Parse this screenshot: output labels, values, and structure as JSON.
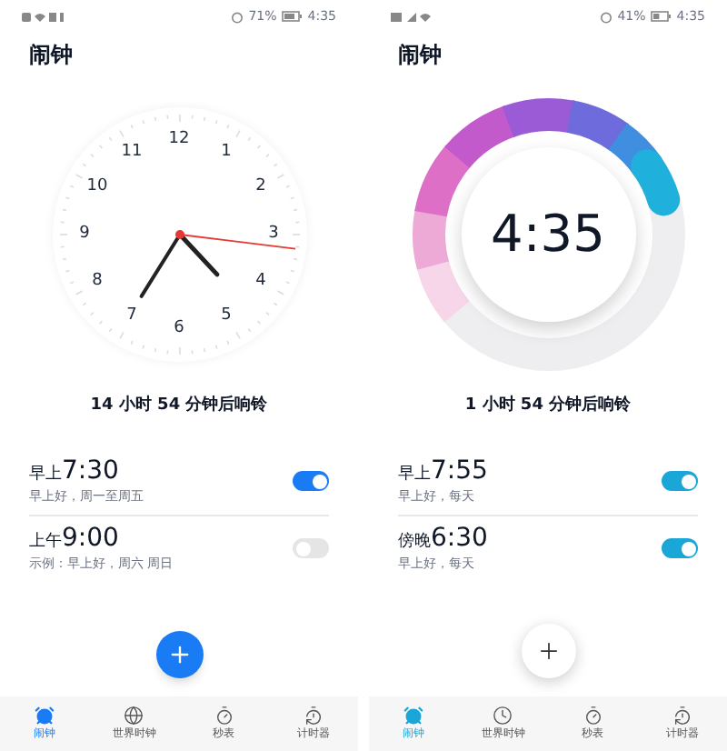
{
  "screens": [
    {
      "kind": "analog",
      "status_bar": {
        "battery": "71%",
        "time": "4:35"
      },
      "title": "闹钟",
      "clock_numbers": [
        "12",
        "1",
        "2",
        "3",
        "4",
        "5",
        "6",
        "7",
        "8",
        "9",
        "10",
        "11"
      ],
      "countdown": "14 小时 54 分钟后响铃",
      "alarms": [
        {
          "period": "早上",
          "time": "7:30",
          "label": "早上好，周一至周五",
          "on": true
        },
        {
          "period": "上午",
          "time": "9:00",
          "label": "示例：早上好，周六 周日",
          "on": false
        }
      ],
      "tabs": [
        {
          "label": "闹钟",
          "selected": true
        },
        {
          "label": "世界时钟",
          "selected": false
        },
        {
          "label": "秒表",
          "selected": false
        },
        {
          "label": "计时器",
          "selected": false
        }
      ]
    },
    {
      "kind": "ring",
      "status_bar": {
        "battery": "41%",
        "time": "4:35"
      },
      "title": "闹钟",
      "clock_time": "4:35",
      "countdown": "1 小时 54 分钟后响铃",
      "alarms": [
        {
          "period": "早上",
          "time": "7:55",
          "label": "早上好，每天",
          "on": true
        },
        {
          "period": "傍晚",
          "time": "6:30",
          "label": "早上好，每天",
          "on": true
        }
      ],
      "tabs": [
        {
          "label": "闹钟",
          "selected": true
        },
        {
          "label": "世界时钟",
          "selected": false
        },
        {
          "label": "秒表",
          "selected": false
        },
        {
          "label": "计时器",
          "selected": false
        }
      ]
    }
  ]
}
